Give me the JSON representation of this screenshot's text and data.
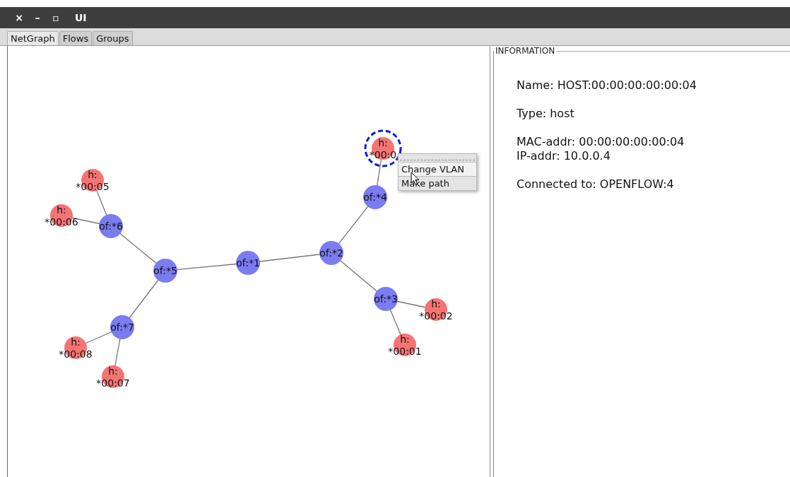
{
  "window": {
    "title": "UI",
    "controls": [
      "×",
      "–",
      "▫"
    ]
  },
  "tabs": [
    {
      "label": "NetGraph",
      "selected": true
    },
    {
      "label": "Flows",
      "selected": false
    },
    {
      "label": "Groups",
      "selected": false
    }
  ],
  "graph": {
    "root": {
      "kind": "switch",
      "label": [
        "of:*1"
      ],
      "selected": false,
      "children": [
        {
          "kind": "switch",
          "label": [
            "of:*5"
          ],
          "selected": false,
          "children": [
            {
              "kind": "switch",
              "label": [
                "of:*6"
              ],
              "selected": false,
              "children": [
                {
                  "kind": "host",
                  "label": [
                    "h:",
                    "*00:05"
                  ],
                  "selected": false
                },
                {
                  "kind": "host",
                  "label": [
                    "h:",
                    "*00:06"
                  ],
                  "selected": false
                }
              ]
            },
            {
              "kind": "switch",
              "label": [
                "of:*7"
              ],
              "selected": false,
              "children": [
                {
                  "kind": "host",
                  "label": [
                    "h:",
                    "*00:08"
                  ],
                  "selected": false
                },
                {
                  "kind": "host",
                  "label": [
                    "h:",
                    "*00:07"
                  ],
                  "selected": false
                }
              ]
            }
          ]
        },
        {
          "kind": "switch",
          "label": [
            "of:*2"
          ],
          "selected": false,
          "children": [
            {
              "kind": "switch",
              "label": [
                "of:*4"
              ],
              "selected": false,
              "children": [
                {
                  "kind": "host",
                  "label": [
                    "h:",
                    "*00:0"
                  ],
                  "selected": true
                }
              ]
            },
            {
              "kind": "switch",
              "label": [
                "of:*3"
              ],
              "selected": false,
              "children": [
                {
                  "kind": "host",
                  "label": [
                    "h:",
                    "*00:02"
                  ],
                  "selected": false
                },
                {
                  "kind": "host",
                  "label": [
                    "h:",
                    "*00:01"
                  ],
                  "selected": false
                }
              ]
            }
          ]
        }
      ]
    }
  },
  "context_menu": {
    "items": [
      {
        "label": "Change VLAN",
        "selected": true
      },
      {
        "label": "Make path",
        "selected": false
      }
    ]
  },
  "information": {
    "title": "INFORMATION",
    "groups": [
      [
        "Name: HOST:00:00:00:00:00:04"
      ],
      [
        "Type: host"
      ],
      [
        "MAC-addr: 00:00:00:00:00:04",
        "IP-addr: 10.0.0.4"
      ],
      [
        "Connected to: OPENFLOW:4"
      ]
    ]
  }
}
